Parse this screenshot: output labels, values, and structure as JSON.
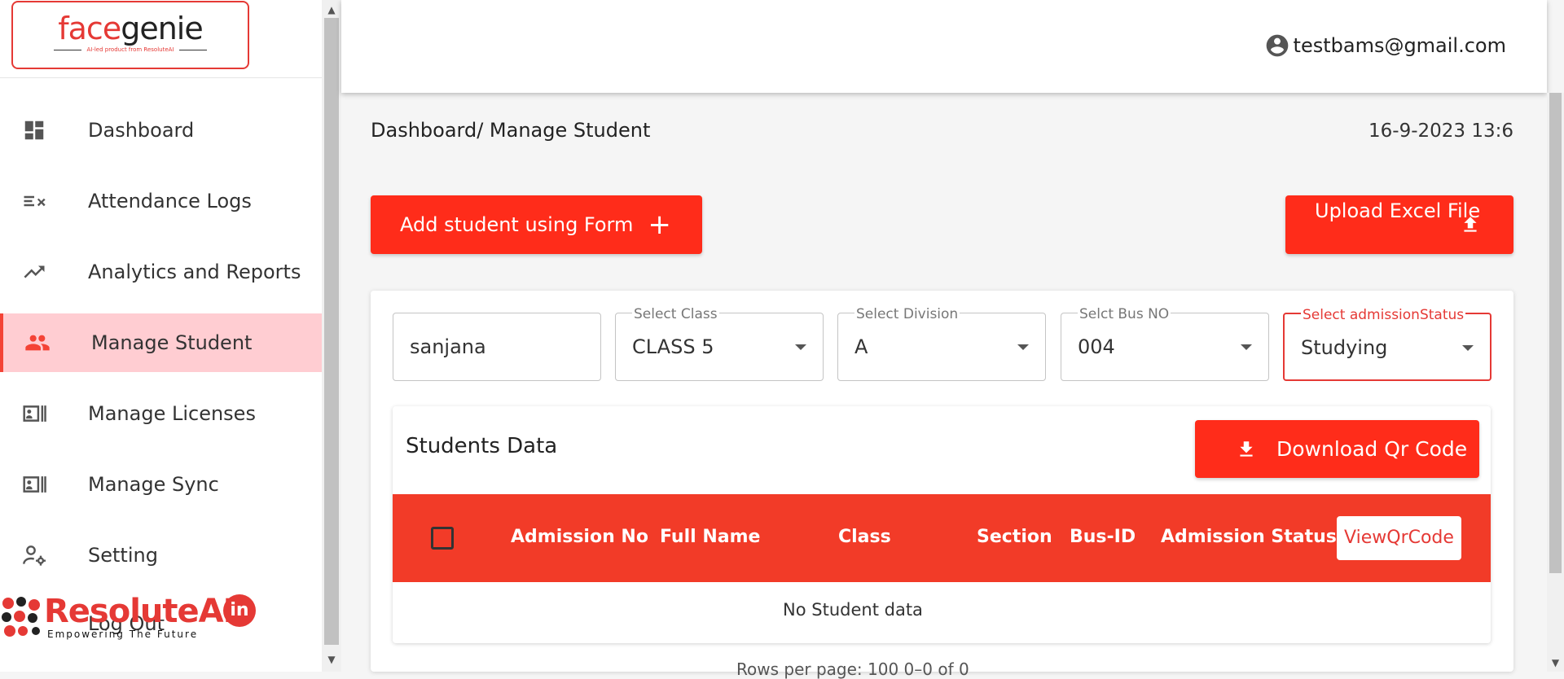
{
  "brand": {
    "logo_main": "face",
    "logo_accent": "genie",
    "logo_tagline": "AI-led product from ResoluteAI",
    "footer_name": "ResoluteAI",
    "footer_suffix": "in",
    "footer_tagline": "Empowering The Future"
  },
  "sidebar": {
    "items": [
      {
        "label": "Dashboard",
        "icon": "dashboard-icon"
      },
      {
        "label": "Attendance Logs",
        "icon": "checklist-icon"
      },
      {
        "label": "Analytics and Reports",
        "icon": "trending-up-icon"
      },
      {
        "label": "Manage Student",
        "icon": "people-icon",
        "active": true
      },
      {
        "label": "Manage Licenses",
        "icon": "badge-icon"
      },
      {
        "label": "Manage Sync",
        "icon": "badge-icon"
      },
      {
        "label": "Setting",
        "icon": "user-settings-icon"
      }
    ],
    "logout_label": "Log Out"
  },
  "header": {
    "user_email": "testbams@gmail.com"
  },
  "page": {
    "breadcrumb": "Dashboard/ Manage Student",
    "datetime": "16-9-2023 13:6",
    "add_form_label": "Add student using Form",
    "upload_label": "Upload Excel File"
  },
  "filters": {
    "search_value": "sanjana",
    "class_label": "Select Class",
    "class_value": "CLASS 5",
    "division_label": "Select Division",
    "division_value": "A",
    "bus_label": "Selct Bus NO",
    "bus_value": "004",
    "status_label": "Select admissionStatus",
    "status_value": "Studying"
  },
  "students": {
    "title": "Students Data",
    "download_label": "Download Qr Code",
    "columns": [
      "Admission No",
      "Full Name",
      "Class",
      "Section",
      "Bus-ID",
      "Admission Status"
    ],
    "view_qr_label": "ViewQrCode",
    "empty_text": "No Student data"
  },
  "pagination": {
    "text": "Rows per page: 100    0–0 of 0"
  },
  "colors": {
    "accent": "#ff2c1a",
    "header_row": "#f23b28",
    "active_bg": "#ffcdd2"
  }
}
